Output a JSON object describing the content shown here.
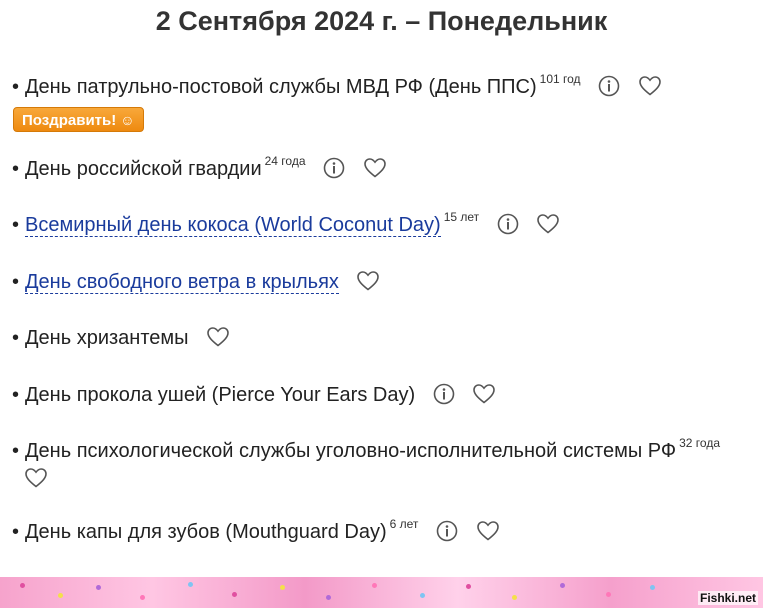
{
  "header": {
    "title": "2 Сентября 2024 г. – Понедельник"
  },
  "congrats_button": {
    "label": "Поздравить!",
    "icon": "smiling-face-icon"
  },
  "items": [
    {
      "text": "День патрульно-постовой службы МВД РФ (День ППС)",
      "age": "101 год",
      "link": false,
      "info": true,
      "fav": true
    },
    {
      "text": "День российской гвардии",
      "age": "24 года",
      "link": false,
      "info": true,
      "fav": true
    },
    {
      "text": "Всемирный день кокоса (World Coconut Day)",
      "age": "15 лет",
      "link": true,
      "info": true,
      "fav": true
    },
    {
      "text": "День свободного ветра в крыльях",
      "age": "",
      "link": true,
      "info": false,
      "fav": true
    },
    {
      "text": "День хризантемы",
      "age": "",
      "link": false,
      "info": false,
      "fav": true
    },
    {
      "text": "День прокола ушей (Pierce Your Ears Day)",
      "age": "",
      "link": false,
      "info": true,
      "fav": true
    },
    {
      "text": "День психологической службы уголовно-исполнительной системы РФ",
      "age": "32 года",
      "link": false,
      "info": false,
      "fav": true
    },
    {
      "text": "День капы для зубов (Mouthguard Day)",
      "age": "6 лет",
      "link": false,
      "info": true,
      "fav": true
    }
  ],
  "footer": {
    "watermark": "Fishki.net"
  },
  "colors": {
    "link": "#1a3b9c",
    "button": "#ee8a10",
    "strip": "#f6a3cc"
  }
}
